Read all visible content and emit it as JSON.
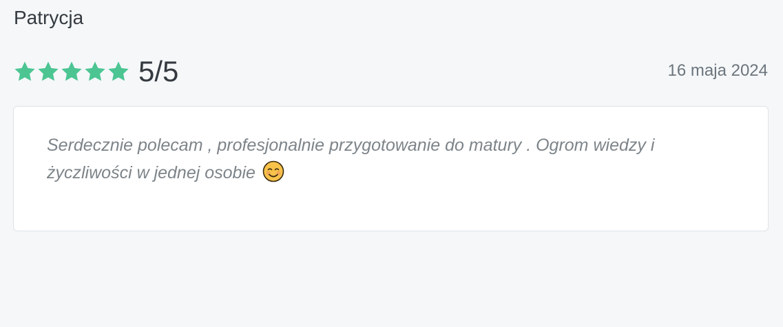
{
  "review": {
    "author": "Patrycja",
    "rating": {
      "score": 5,
      "max": 5,
      "label": "5/5",
      "star_color": "#4cc593"
    },
    "date": "16 maja 2024",
    "comment": "Serdecznie polecam , profesjonalnie przygotowanie do matury . Ogrom wiedzy i życzliwości w jednej osobie",
    "emoji_icon": "smiling-face-icon"
  }
}
